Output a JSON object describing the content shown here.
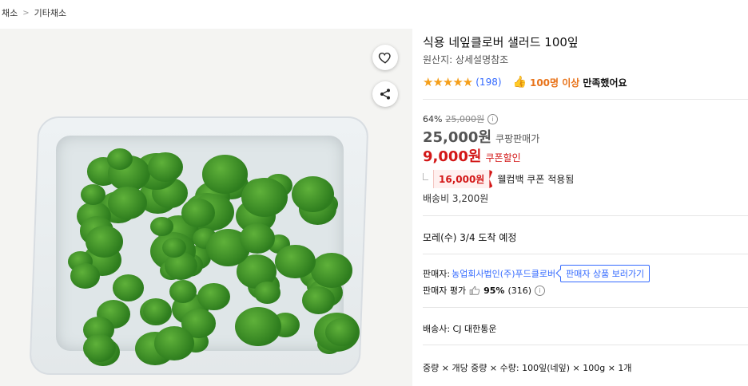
{
  "breadcrumb": {
    "items": [
      "채소",
      "기타채소"
    ],
    "separator": ">"
  },
  "product": {
    "title": "식용 네잎클로버 샐러드 100잎",
    "origin": "원산지: 상세설명참조",
    "rating": {
      "stars": 5,
      "count": "(198)"
    },
    "satisfaction": {
      "count_text": "100명 이상",
      "suffix": "만족했어요"
    }
  },
  "price": {
    "discount": "64%",
    "original": "25,000원",
    "coupang_price": "25,000원",
    "coupang_label": "쿠팡판매가",
    "coupon_price": "9,000원",
    "coupon_label": "쿠폰할인",
    "welcome_amount": "16,000원",
    "welcome_label": "웰컴백 쿠폰 적용됨",
    "shipping_fee": "배송비 3,200원"
  },
  "delivery": {
    "arrival": "모레(수) 3/4 도착 예정"
  },
  "seller": {
    "label": "판매자:",
    "name": "농업회사법인(주)푸드클로버",
    "button": "판매자 상품 보러가기",
    "eval_label": "판매자 평가",
    "eval_percent": "95%",
    "eval_count": "(316)"
  },
  "shipping_company": "배송사:  CJ 대한통운",
  "spec": "중량 × 개당 중량 × 수량: 100잎(네잎) × 100g × 1개",
  "colors": {
    "accent_red": "#d31818",
    "link_blue": "#346aff",
    "star": "#f59f1a",
    "orange": "#e8731a"
  }
}
